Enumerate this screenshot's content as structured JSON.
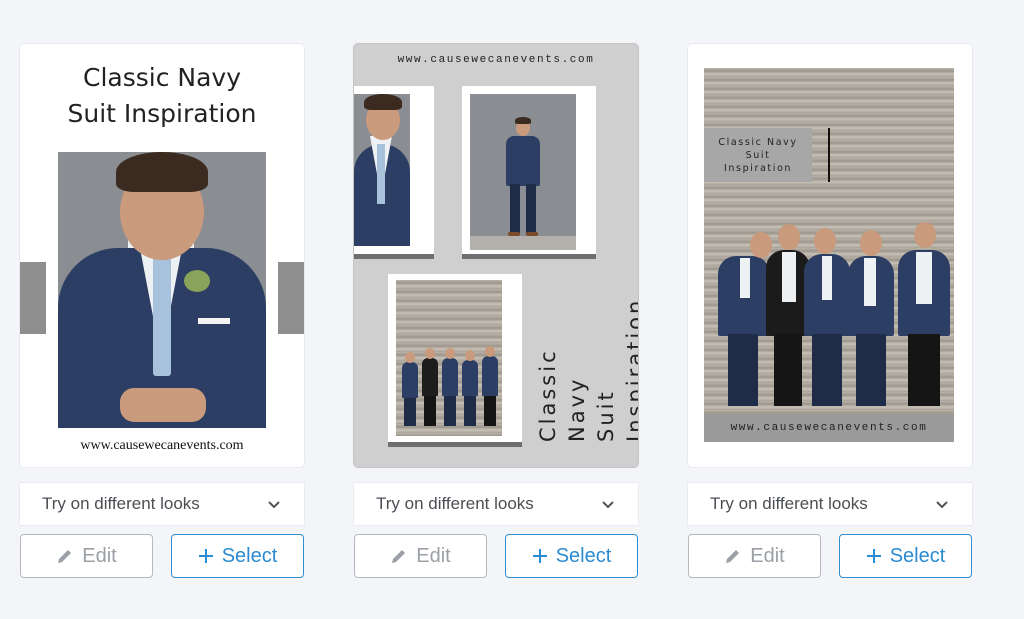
{
  "templates": [
    {
      "title_line1": "Classic Navy",
      "title_line2": "Suit Inspiration",
      "url": "www.causewecanevents.com",
      "dropdown_label": "Try on different looks",
      "edit_label": "Edit",
      "select_label": "Select"
    },
    {
      "url": "www.causewecanevents.com",
      "title": "Classic Navy\nSuit\nInspiration",
      "dropdown_label": "Try on different looks",
      "edit_label": "Edit",
      "select_label": "Select"
    },
    {
      "title": "Classic Navy\nSuit\nInspiration",
      "url": "www.causewecanevents.com",
      "dropdown_label": "Try on different looks",
      "edit_label": "Edit",
      "select_label": "Select"
    }
  ],
  "icons": {
    "dropdown": "chevron-down-icon",
    "edit": "pencil-icon",
    "select": "plus-icon"
  },
  "colors": {
    "accent": "#2b8bd2",
    "background": "#f3f5f8",
    "navy_suit": "#2c3e63"
  }
}
